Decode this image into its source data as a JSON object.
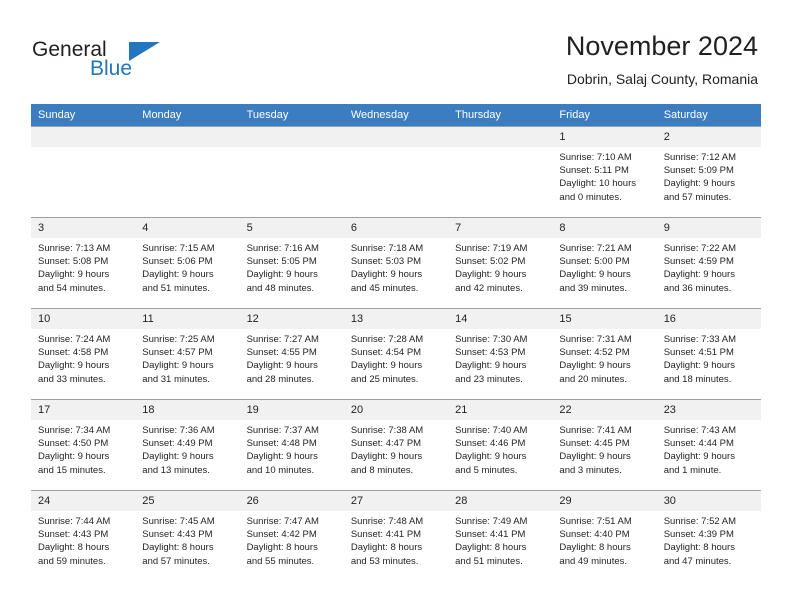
{
  "brand": {
    "name_part1": "General",
    "name_part2": "Blue",
    "accent_color": "#2176bd",
    "triangle_icon": "triangle-icon"
  },
  "header": {
    "title": "November 2024",
    "subtitle": "Dobrin, Salaj County, Romania"
  },
  "calendar": {
    "header_bg": "#3b7dc0",
    "daynum_bg": "#f1f1f1",
    "weekdays": [
      "Sunday",
      "Monday",
      "Tuesday",
      "Wednesday",
      "Thursday",
      "Friday",
      "Saturday"
    ],
    "weeks": [
      [
        {
          "day": "",
          "blank": true,
          "lines": []
        },
        {
          "day": "",
          "blank": true,
          "lines": []
        },
        {
          "day": "",
          "blank": true,
          "lines": []
        },
        {
          "day": "",
          "blank": true,
          "lines": []
        },
        {
          "day": "",
          "blank": true,
          "lines": []
        },
        {
          "day": "1",
          "blank": false,
          "lines": [
            "Sunrise: 7:10 AM",
            "Sunset: 5:11 PM",
            "Daylight: 10 hours",
            "and 0 minutes."
          ]
        },
        {
          "day": "2",
          "blank": false,
          "lines": [
            "Sunrise: 7:12 AM",
            "Sunset: 5:09 PM",
            "Daylight: 9 hours",
            "and 57 minutes."
          ]
        }
      ],
      [
        {
          "day": "3",
          "blank": false,
          "lines": [
            "Sunrise: 7:13 AM",
            "Sunset: 5:08 PM",
            "Daylight: 9 hours",
            "and 54 minutes."
          ]
        },
        {
          "day": "4",
          "blank": false,
          "lines": [
            "Sunrise: 7:15 AM",
            "Sunset: 5:06 PM",
            "Daylight: 9 hours",
            "and 51 minutes."
          ]
        },
        {
          "day": "5",
          "blank": false,
          "lines": [
            "Sunrise: 7:16 AM",
            "Sunset: 5:05 PM",
            "Daylight: 9 hours",
            "and 48 minutes."
          ]
        },
        {
          "day": "6",
          "blank": false,
          "lines": [
            "Sunrise: 7:18 AM",
            "Sunset: 5:03 PM",
            "Daylight: 9 hours",
            "and 45 minutes."
          ]
        },
        {
          "day": "7",
          "blank": false,
          "lines": [
            "Sunrise: 7:19 AM",
            "Sunset: 5:02 PM",
            "Daylight: 9 hours",
            "and 42 minutes."
          ]
        },
        {
          "day": "8",
          "blank": false,
          "lines": [
            "Sunrise: 7:21 AM",
            "Sunset: 5:00 PM",
            "Daylight: 9 hours",
            "and 39 minutes."
          ]
        },
        {
          "day": "9",
          "blank": false,
          "lines": [
            "Sunrise: 7:22 AM",
            "Sunset: 4:59 PM",
            "Daylight: 9 hours",
            "and 36 minutes."
          ]
        }
      ],
      [
        {
          "day": "10",
          "blank": false,
          "lines": [
            "Sunrise: 7:24 AM",
            "Sunset: 4:58 PM",
            "Daylight: 9 hours",
            "and 33 minutes."
          ]
        },
        {
          "day": "11",
          "blank": false,
          "lines": [
            "Sunrise: 7:25 AM",
            "Sunset: 4:57 PM",
            "Daylight: 9 hours",
            "and 31 minutes."
          ]
        },
        {
          "day": "12",
          "blank": false,
          "lines": [
            "Sunrise: 7:27 AM",
            "Sunset: 4:55 PM",
            "Daylight: 9 hours",
            "and 28 minutes."
          ]
        },
        {
          "day": "13",
          "blank": false,
          "lines": [
            "Sunrise: 7:28 AM",
            "Sunset: 4:54 PM",
            "Daylight: 9 hours",
            "and 25 minutes."
          ]
        },
        {
          "day": "14",
          "blank": false,
          "lines": [
            "Sunrise: 7:30 AM",
            "Sunset: 4:53 PM",
            "Daylight: 9 hours",
            "and 23 minutes."
          ]
        },
        {
          "day": "15",
          "blank": false,
          "lines": [
            "Sunrise: 7:31 AM",
            "Sunset: 4:52 PM",
            "Daylight: 9 hours",
            "and 20 minutes."
          ]
        },
        {
          "day": "16",
          "blank": false,
          "lines": [
            "Sunrise: 7:33 AM",
            "Sunset: 4:51 PM",
            "Daylight: 9 hours",
            "and 18 minutes."
          ]
        }
      ],
      [
        {
          "day": "17",
          "blank": false,
          "lines": [
            "Sunrise: 7:34 AM",
            "Sunset: 4:50 PM",
            "Daylight: 9 hours",
            "and 15 minutes."
          ]
        },
        {
          "day": "18",
          "blank": false,
          "lines": [
            "Sunrise: 7:36 AM",
            "Sunset: 4:49 PM",
            "Daylight: 9 hours",
            "and 13 minutes."
          ]
        },
        {
          "day": "19",
          "blank": false,
          "lines": [
            "Sunrise: 7:37 AM",
            "Sunset: 4:48 PM",
            "Daylight: 9 hours",
            "and 10 minutes."
          ]
        },
        {
          "day": "20",
          "blank": false,
          "lines": [
            "Sunrise: 7:38 AM",
            "Sunset: 4:47 PM",
            "Daylight: 9 hours",
            "and 8 minutes."
          ]
        },
        {
          "day": "21",
          "blank": false,
          "lines": [
            "Sunrise: 7:40 AM",
            "Sunset: 4:46 PM",
            "Daylight: 9 hours",
            "and 5 minutes."
          ]
        },
        {
          "day": "22",
          "blank": false,
          "lines": [
            "Sunrise: 7:41 AM",
            "Sunset: 4:45 PM",
            "Daylight: 9 hours",
            "and 3 minutes."
          ]
        },
        {
          "day": "23",
          "blank": false,
          "lines": [
            "Sunrise: 7:43 AM",
            "Sunset: 4:44 PM",
            "Daylight: 9 hours",
            "and 1 minute."
          ]
        }
      ],
      [
        {
          "day": "24",
          "blank": false,
          "lines": [
            "Sunrise: 7:44 AM",
            "Sunset: 4:43 PM",
            "Daylight: 8 hours",
            "and 59 minutes."
          ]
        },
        {
          "day": "25",
          "blank": false,
          "lines": [
            "Sunrise: 7:45 AM",
            "Sunset: 4:43 PM",
            "Daylight: 8 hours",
            "and 57 minutes."
          ]
        },
        {
          "day": "26",
          "blank": false,
          "lines": [
            "Sunrise: 7:47 AM",
            "Sunset: 4:42 PM",
            "Daylight: 8 hours",
            "and 55 minutes."
          ]
        },
        {
          "day": "27",
          "blank": false,
          "lines": [
            "Sunrise: 7:48 AM",
            "Sunset: 4:41 PM",
            "Daylight: 8 hours",
            "and 53 minutes."
          ]
        },
        {
          "day": "28",
          "blank": false,
          "lines": [
            "Sunrise: 7:49 AM",
            "Sunset: 4:41 PM",
            "Daylight: 8 hours",
            "and 51 minutes."
          ]
        },
        {
          "day": "29",
          "blank": false,
          "lines": [
            "Sunrise: 7:51 AM",
            "Sunset: 4:40 PM",
            "Daylight: 8 hours",
            "and 49 minutes."
          ]
        },
        {
          "day": "30",
          "blank": false,
          "lines": [
            "Sunrise: 7:52 AM",
            "Sunset: 4:39 PM",
            "Daylight: 8 hours",
            "and 47 minutes."
          ]
        }
      ]
    ]
  }
}
